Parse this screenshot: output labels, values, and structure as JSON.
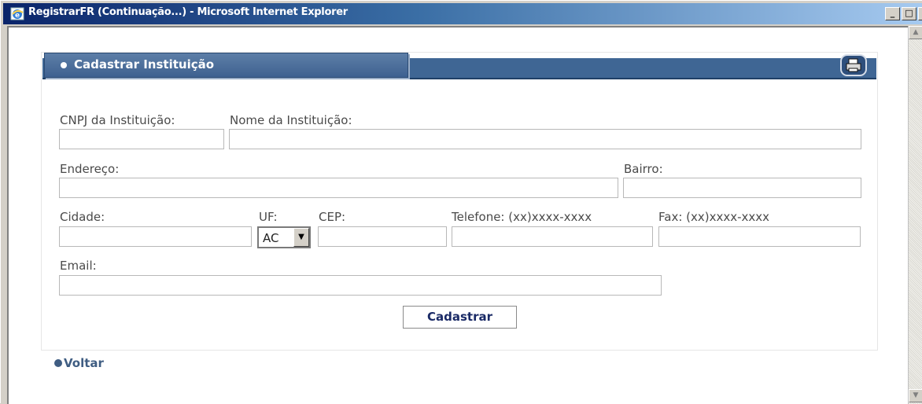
{
  "window": {
    "title": "RegistrarFR (Continuação...) - Microsoft Internet Explorer",
    "minimize": "_",
    "maximize": "□",
    "close": "×"
  },
  "header": {
    "title": "Cadastrar Instituição",
    "print_icon": "printer-icon"
  },
  "form": {
    "cnpj_label": "CNPJ da Instituição:",
    "cnpj_value": "",
    "nome_label": "Nome da Instituição:",
    "nome_value": "",
    "endereco_label": "Endereço:",
    "endereco_value": "",
    "bairro_label": "Bairro:",
    "bairro_value": "",
    "cidade_label": "Cidade:",
    "cidade_value": "",
    "uf_label": "UF:",
    "uf_value": "AC",
    "cep_label": "CEP:",
    "cep_value": "",
    "telefone_label": "Telefone: (xx)xxxx-xxxx",
    "telefone_value": "",
    "fax_label": "Fax: (xx)xxxx-xxxx",
    "fax_value": "",
    "email_label": "Email:",
    "email_value": "",
    "submit_label": "Cadastrar"
  },
  "nav": {
    "back_label": "Voltar"
  },
  "colors": {
    "header_bar": "#3f6694",
    "link": "#3f5d82",
    "button_text": "#1a2a66"
  }
}
